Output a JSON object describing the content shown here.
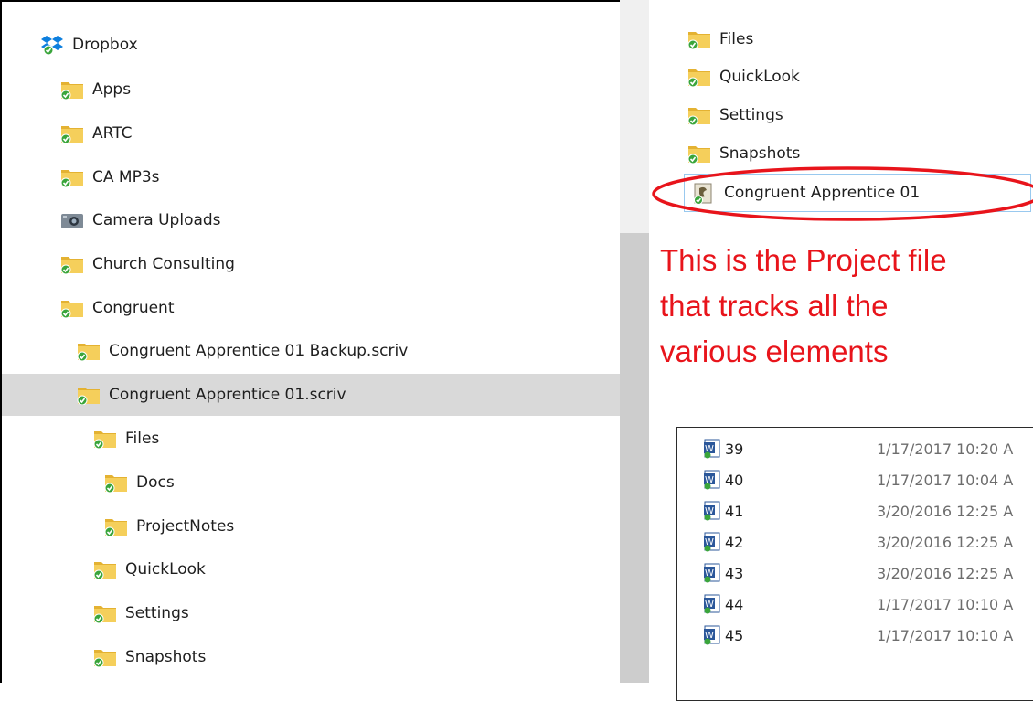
{
  "tree": {
    "root": {
      "label": "Dropbox",
      "icon": "dropbox-icon"
    },
    "items": [
      {
        "label": "Apps",
        "icon": "synced-folder-icon"
      },
      {
        "label": "ARTC",
        "icon": "synced-folder-icon"
      },
      {
        "label": "CA MP3s",
        "icon": "synced-folder-icon"
      },
      {
        "label": "Camera Uploads",
        "icon": "camera-folder-icon"
      },
      {
        "label": "Church Consulting",
        "icon": "synced-folder-icon"
      },
      {
        "label": "Congruent",
        "icon": "synced-folder-icon"
      },
      {
        "label": "Congruent Apprentice 01 Backup.scriv",
        "icon": "synced-folder-icon"
      },
      {
        "label": "Congruent Apprentice 01.scriv",
        "icon": "synced-folder-icon",
        "selected": true
      },
      {
        "label": "Files",
        "icon": "synced-folder-icon"
      },
      {
        "label": "Docs",
        "icon": "synced-folder-icon"
      },
      {
        "label": "ProjectNotes",
        "icon": "synced-folder-icon"
      },
      {
        "label": "QuickLook",
        "icon": "synced-folder-icon"
      },
      {
        "label": "Settings",
        "icon": "synced-folder-icon"
      },
      {
        "label": "Snapshots",
        "icon": "synced-folder-icon"
      }
    ]
  },
  "content": {
    "folders": [
      {
        "label": "Files",
        "icon": "synced-folder-icon"
      },
      {
        "label": "QuickLook",
        "icon": "synced-folder-icon"
      },
      {
        "label": "Settings",
        "icon": "synced-folder-icon"
      },
      {
        "label": "Snapshots",
        "icon": "synced-folder-icon"
      }
    ],
    "project_file": {
      "label": "Congruent Apprentice 01",
      "icon": "scrivener-project-icon"
    }
  },
  "annotation": {
    "lines": [
      "This is the Project file",
      "that tracks all the",
      "various elements"
    ],
    "color": "#e8141b"
  },
  "file_list": {
    "rows": [
      {
        "name": "39",
        "date": "1/17/2017 10:20 A",
        "icon": "word-doc-icon"
      },
      {
        "name": "40",
        "date": "1/17/2017 10:04 A",
        "icon": "word-doc-icon"
      },
      {
        "name": "41",
        "date": "3/20/2016 12:25 A",
        "icon": "word-doc-icon"
      },
      {
        "name": "42",
        "date": "3/20/2016 12:25 A",
        "icon": "word-doc-icon"
      },
      {
        "name": "43",
        "date": "3/20/2016 12:25 A",
        "icon": "word-doc-icon"
      },
      {
        "name": "44",
        "date": "1/17/2017 10:10 A",
        "icon": "word-doc-icon"
      },
      {
        "name": "45",
        "date": "1/17/2017 10:10 A",
        "icon": "word-doc-icon"
      }
    ]
  },
  "colors": {
    "folder": "#f5cf5b",
    "folder_dark": "#e4b232",
    "sync_badge": "#3aa53b",
    "selection": "#d9d9d9",
    "highlight_ellipse": "#e8141b"
  }
}
